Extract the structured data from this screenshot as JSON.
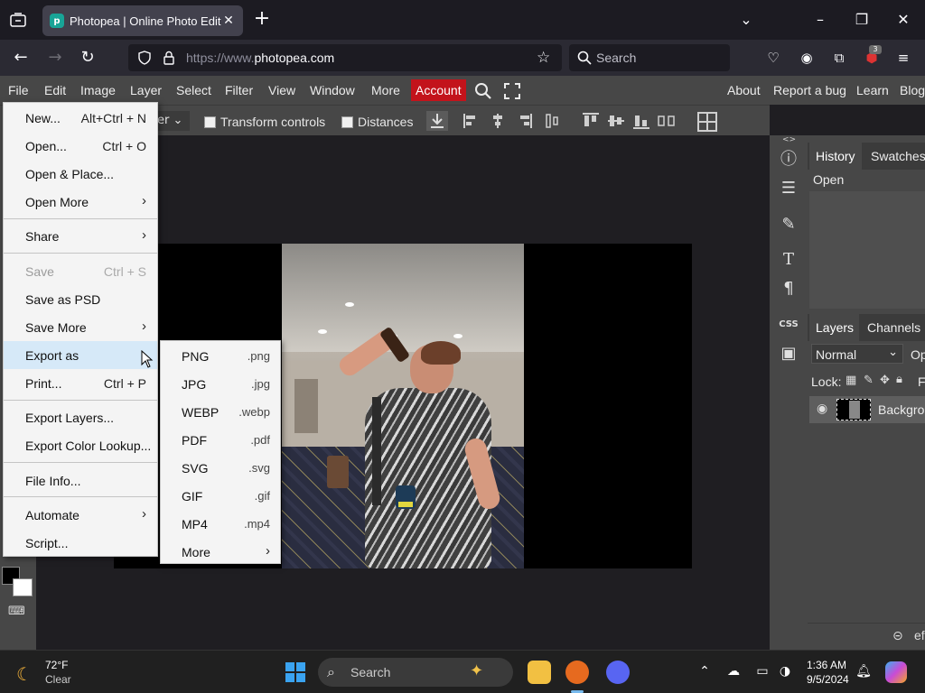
{
  "browser": {
    "tab_title": "Photopea | Online Photo Editor",
    "url_scheme": "https://www.",
    "url_host": "photopea.com",
    "search_placeholder": "Search",
    "extension_badge": "3"
  },
  "menubar": {
    "items": [
      "File",
      "Edit",
      "Image",
      "Layer",
      "Select",
      "Filter",
      "View",
      "Window",
      "More"
    ],
    "account": "Account",
    "right_links": [
      "About",
      "Report a bug",
      "Learn",
      "Blog"
    ]
  },
  "optbar": {
    "dropdown_partial": "er",
    "transform_controls": "Transform controls",
    "distances": "Distances"
  },
  "file_menu": {
    "items": [
      {
        "label": "New...",
        "shortcut": "Alt+Ctrl + N"
      },
      {
        "label": "Open...",
        "shortcut": "Ctrl + O"
      },
      {
        "label": "Open & Place...",
        "shortcut": ""
      },
      {
        "label": "Open More",
        "shortcut": ""
      },
      {
        "label": "Share",
        "shortcut": ""
      },
      {
        "label": "Save",
        "shortcut": "Ctrl + S"
      },
      {
        "label": "Save as PSD",
        "shortcut": ""
      },
      {
        "label": "Save More",
        "shortcut": ""
      },
      {
        "label": "Export as",
        "shortcut": ""
      },
      {
        "label": "Print...",
        "shortcut": "Ctrl + P"
      },
      {
        "label": "Export Layers...",
        "shortcut": ""
      },
      {
        "label": "Export Color Lookup...",
        "shortcut": ""
      },
      {
        "label": "File Info...",
        "shortcut": ""
      },
      {
        "label": "Automate",
        "shortcut": ""
      },
      {
        "label": "Script...",
        "shortcut": ""
      }
    ]
  },
  "export_submenu": {
    "items": [
      {
        "label": "PNG",
        "ext": ".png"
      },
      {
        "label": "JPG",
        "ext": ".jpg"
      },
      {
        "label": "WEBP",
        "ext": ".webp"
      },
      {
        "label": "PDF",
        "ext": ".pdf"
      },
      {
        "label": "SVG",
        "ext": ".svg"
      },
      {
        "label": "GIF",
        "ext": ".gif"
      },
      {
        "label": "MP4",
        "ext": ".mp4"
      },
      {
        "label": "More",
        "ext": ""
      }
    ]
  },
  "panels": {
    "history_tab": "History",
    "swatches_tab": "Swatches",
    "history_item": "Open",
    "layers_tab": "Layers",
    "channels_tab": "Channels",
    "blend_mode": "Normal",
    "opacity_partial": "Op",
    "lock_label": "Lock:",
    "fill_partial": "F",
    "layer_name": "Backgrou",
    "css_label": "CSS",
    "footer_partial": "ef"
  },
  "taskbar": {
    "temp": "72°F",
    "condition": "Clear",
    "search_placeholder": "Search",
    "time": "1:36 AM",
    "date": "9/5/2024"
  }
}
